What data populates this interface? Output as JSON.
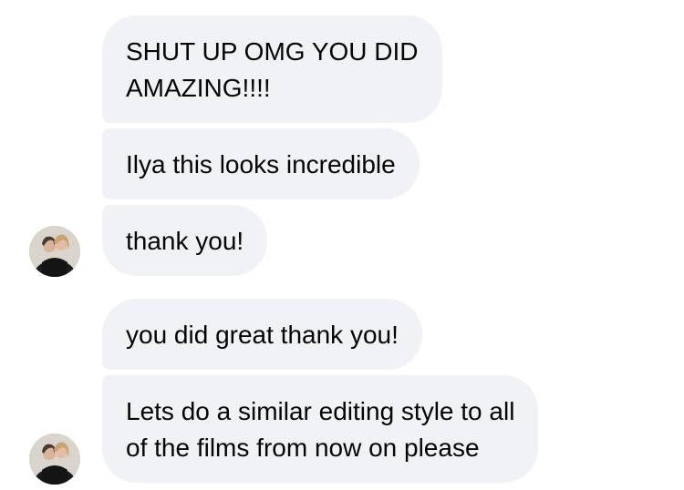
{
  "messages": [
    {
      "lines": [
        "SHUT UP OMG YOU DID",
        "AMAZING!!!!"
      ]
    },
    {
      "lines": [
        "Ilya this looks incredible"
      ]
    },
    {
      "lines": [
        "thank you!"
      ]
    },
    {
      "lines": [
        "you did great thank you!"
      ]
    },
    {
      "lines": [
        "Lets do a similar editing style to all",
        "of the films from now on please"
      ]
    }
  ],
  "colors": {
    "bubble_background": "#f0f2f5",
    "text": "#050505",
    "page_background": "#ffffff"
  },
  "icons": {
    "avatar": "couple-photo-avatar"
  }
}
